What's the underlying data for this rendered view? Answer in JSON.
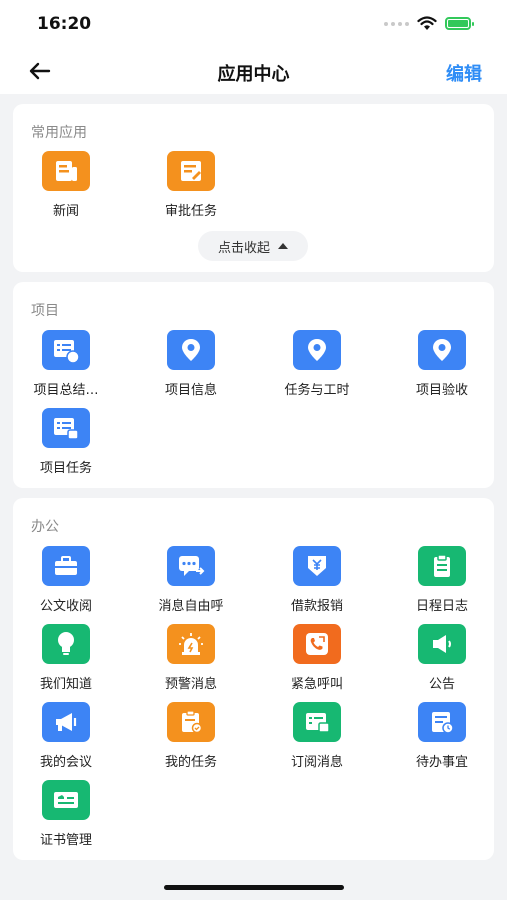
{
  "status": {
    "time": "16:20"
  },
  "nav": {
    "title": "应用中心",
    "edit": "编辑"
  },
  "sections": {
    "common": {
      "title": "常用应用",
      "apps": [
        {
          "label": "新闻",
          "icon": "news-icon"
        },
        {
          "label": "审批任务",
          "icon": "approval-task-icon"
        }
      ],
      "collapse": "点击收起"
    },
    "project": {
      "title": "项目",
      "apps": [
        {
          "label": "项目总结…",
          "icon": "project-summary-icon"
        },
        {
          "label": "项目信息",
          "icon": "location-pin-icon"
        },
        {
          "label": "任务与工时",
          "icon": "location-pin-icon"
        },
        {
          "label": "项目验收",
          "icon": "location-pin-icon"
        },
        {
          "label": "项目任务",
          "icon": "project-task-icon"
        }
      ]
    },
    "office": {
      "title": "办公",
      "apps": [
        {
          "label": "公文收阅",
          "icon": "briefcase-icon"
        },
        {
          "label": "消息自由呼",
          "icon": "message-forward-icon"
        },
        {
          "label": "借款报销",
          "icon": "yuan-icon"
        },
        {
          "label": "日程日志",
          "icon": "clipboard-icon"
        },
        {
          "label": "我们知道",
          "icon": "lightbulb-icon"
        },
        {
          "label": "预警消息",
          "icon": "alarm-icon"
        },
        {
          "label": "紧急呼叫",
          "icon": "phone-icon"
        },
        {
          "label": "公告",
          "icon": "speaker-icon"
        },
        {
          "label": "我的会议",
          "icon": "megaphone-icon"
        },
        {
          "label": "我的任务",
          "icon": "task-check-icon"
        },
        {
          "label": "订阅消息",
          "icon": "subscribe-icon"
        },
        {
          "label": "待办事宜",
          "icon": "todo-icon"
        },
        {
          "label": "证书管理",
          "icon": "certificate-icon"
        }
      ]
    }
  },
  "colors": {
    "blue": "#3d84f5",
    "orange": "#f4911e",
    "green": "#17b872",
    "red": "#f16b1e",
    "accent": "#2f8df6"
  }
}
